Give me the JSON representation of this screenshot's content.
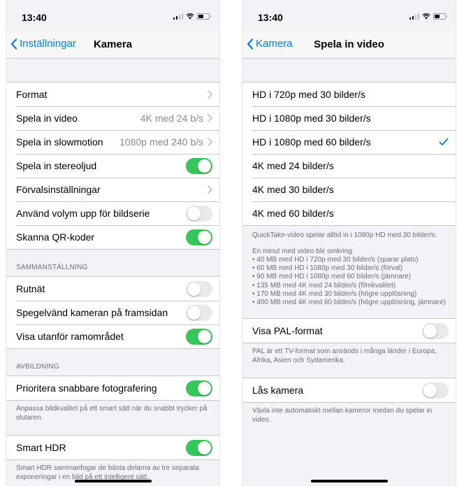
{
  "left": {
    "status": {
      "time": "13:40"
    },
    "nav": {
      "back_label": "Inställningar",
      "title": "Kamera"
    },
    "group1": [
      {
        "label": "Format",
        "value": "",
        "type": "chevron"
      },
      {
        "label": "Spela in video",
        "value": "4K med 24 b/s",
        "type": "chevron"
      },
      {
        "label": "Spela in slowmotion",
        "value": "1080p med 240 b/s",
        "type": "chevron"
      },
      {
        "label": "Spela in stereoljud",
        "type": "toggle",
        "on": true
      },
      {
        "label": "Förvalsinställningar",
        "value": "",
        "type": "chevron"
      },
      {
        "label": "Använd volym upp för bildserie",
        "type": "toggle",
        "on": false
      },
      {
        "label": "Skanna QR-koder",
        "type": "toggle",
        "on": true
      }
    ],
    "composition": {
      "header": "SAMMANSTÄLLNING",
      "rows": [
        {
          "label": "Rutnät",
          "on": false
        },
        {
          "label": "Spegelvänd kameran på framsidan",
          "on": false
        },
        {
          "label": "Visa utanför ramområdet",
          "on": true
        }
      ]
    },
    "capture": {
      "header": "AVBILDNING",
      "row_label": "Prioritera snabbare fotografering",
      "row_on": true,
      "footer": "Anpassa bildkvalitet på ett smart sätt när du snabbt trycker på slutaren."
    },
    "hdr": {
      "row_label": "Smart HDR",
      "row_on": true,
      "footer": "Smart HDR sammanfogar de bästa delarna av tre separata exponeringar i en bild på ett intelligent sätt."
    }
  },
  "right": {
    "status": {
      "time": "13:40"
    },
    "nav": {
      "back_label": "Kamera",
      "title": "Spela in video"
    },
    "formats": [
      {
        "label": "HD i 720p med 30 bilder/s",
        "selected": false
      },
      {
        "label": "HD i 1080p med 30 bilder/s",
        "selected": false
      },
      {
        "label": "HD i 1080p med 60 bilder/s",
        "selected": true
      },
      {
        "label": "4K med 24 bilder/s",
        "selected": false
      },
      {
        "label": "4K med 30 bilder/s",
        "selected": false
      },
      {
        "label": "4K med 60 bilder/s",
        "selected": false
      }
    ],
    "info": {
      "quicktake": "QuickTake-video spelar alltid in i 1080p HD med 30 bilder/s.",
      "minute_intro": "En minut med video blir omkring:",
      "lines": [
        "• 40 MB med HD i 720p med 30 bilder/s (sparar plats)",
        "• 60 MB med HD i 1080p med 30 bilder/s (förval)",
        "• 90 MB med HD i 1080p med 60 bilder/s (jämnare)",
        "• 135 MB med 4K med 24 bilder/s (filmkvalitet)",
        "• 170 MB med 4K med 30 bilder/s (högre upplösning)",
        "• 400 MB med 4K med 60 bilder/s (högre upplösning, jämnare)"
      ]
    },
    "pal": {
      "label": "Visa PAL-format",
      "on": false,
      "footer": "PAL är ett TV-format som används i många länder i Europa, Afrika, Asien och Sydamerika."
    },
    "lock": {
      "label": "Lås kamera",
      "on": false,
      "footer": "Växla inte automatiskt mellan kameror medan du spelar in video."
    }
  },
  "colors": {
    "accent": "#007aff",
    "toggle_on": "#34c759",
    "toggle_off": "#e9e9eb"
  }
}
